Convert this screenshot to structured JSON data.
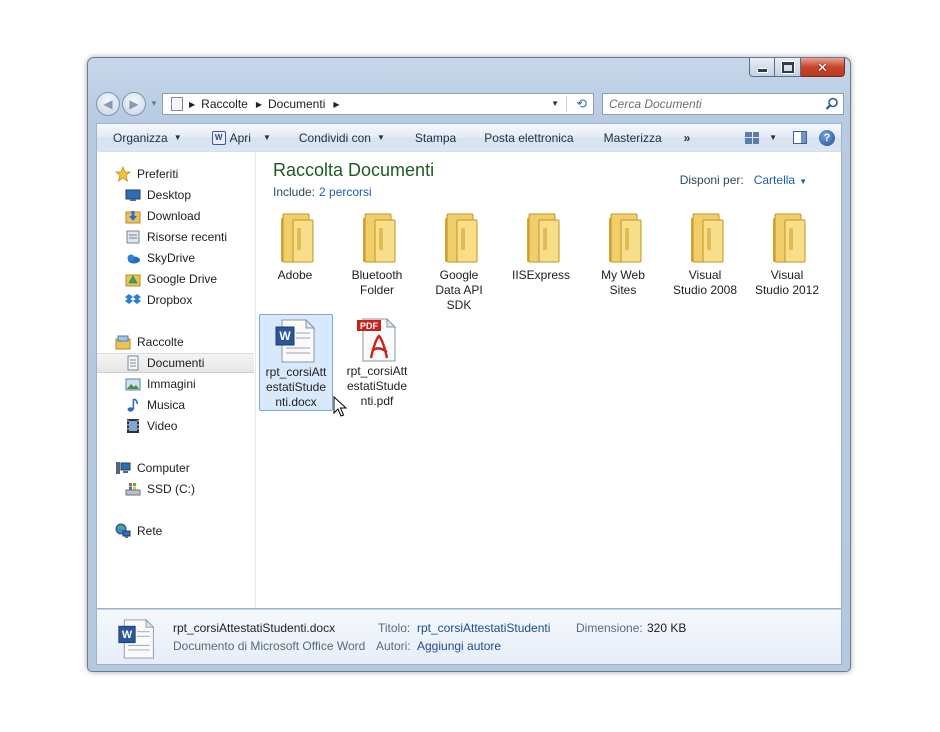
{
  "address": {
    "crumbs": [
      "Raccolte",
      "Documenti"
    ]
  },
  "search": {
    "placeholder": "Cerca Documenti"
  },
  "toolbar": {
    "organize": "Organizza",
    "open": "Apri",
    "share": "Condividi con",
    "print": "Stampa",
    "email": "Posta elettronica",
    "burn": "Masterizza",
    "more": "»"
  },
  "sidebar": {
    "favorites": {
      "label": "Preferiti",
      "items": [
        "Desktop",
        "Download",
        "Risorse recenti",
        "SkyDrive",
        "Google Drive",
        "Dropbox"
      ]
    },
    "libraries": {
      "label": "Raccolte",
      "items": [
        "Documenti",
        "Immagini",
        "Musica",
        "Video"
      ]
    },
    "computer": {
      "label": "Computer",
      "items": [
        "SSD (C:)"
      ]
    },
    "network": {
      "label": "Rete"
    }
  },
  "library": {
    "title": "Raccolta Documenti",
    "include_label": "Include:",
    "include_link": "2 percorsi",
    "arrange_label": "Disponi per:",
    "arrange_value": "Cartella"
  },
  "folders": [
    "Adobe",
    "Bluetooth Folder",
    "Google Data API SDK",
    "IISExpress",
    "My Web Sites",
    "Visual Studio 2008",
    "Visual Studio 2012"
  ],
  "files": [
    {
      "name": "rpt_corsiAttestatiStudenti.docx",
      "type": "docx",
      "selected": true
    },
    {
      "name": "rpt_corsiAttestatiStudenti.pdf",
      "type": "pdf",
      "selected": false
    }
  ],
  "details": {
    "name": "rpt_corsiAttestatiStudenti.docx",
    "type": "Documento di Microsoft Office Word",
    "title_label": "Titolo:",
    "title_value": "rpt_corsiAttestatiStudenti",
    "size_label": "Dimensione:",
    "size_value": "320 KB",
    "authors_label": "Autori:",
    "authors_value": "Aggiungi autore"
  },
  "icons": {
    "favorites": "star-icon",
    "desktop": "desktop-icon",
    "download": "download-folder-icon",
    "recent": "recent-places-icon",
    "skydrive": "skydrive-icon",
    "googledrive": "google-drive-icon",
    "dropbox": "dropbox-icon",
    "libraries": "libraries-icon",
    "documents": "documents-icon",
    "pictures": "pictures-icon",
    "music": "music-icon",
    "video": "video-icon",
    "computer": "computer-icon",
    "drive": "hard-drive-icon",
    "network": "network-icon"
  }
}
